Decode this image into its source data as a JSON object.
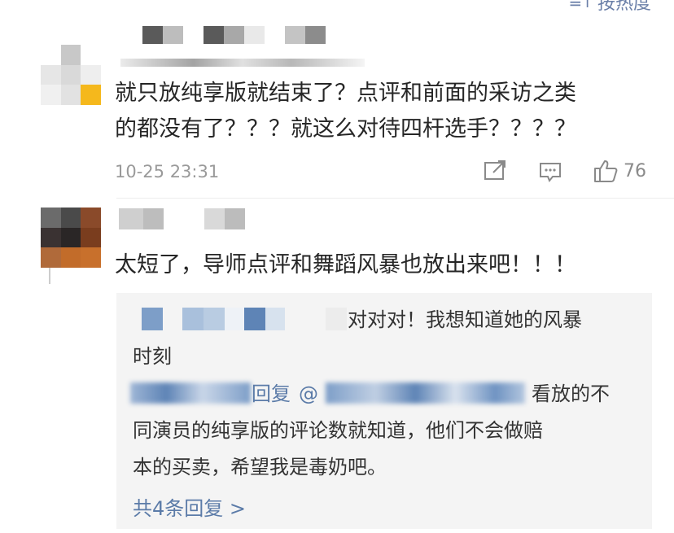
{
  "sort": {
    "icon": "sort-icon",
    "label": "按热度"
  },
  "comments": [
    {
      "text_line1": "就只放纯享版就结束了？点评和前面的采访之类",
      "text_line2": "的都没有了？？？就这么对待四杆选手？？？？",
      "timestamp": "10-25 23:31",
      "like_count": "76"
    },
    {
      "text": "太短了，导师点评和舞蹈风暴也放出来吧！！！",
      "replies": [
        {
          "text_line1": "对对对！我想知道她的风暴",
          "text_line2": "时刻"
        },
        {
          "reply_prefix": "回复",
          "mention_at": "@",
          "text_tail": "看放的不",
          "text_line2": "同演员的纯享版的评论数就知道，他们不会做赔",
          "text_line3": "本的买卖，希望我是毒奶吧。"
        }
      ],
      "more_replies_label": "共4条回复 >"
    }
  ],
  "colors": {
    "link": "#5b7ba8",
    "reply_bg": "#f4f4f4",
    "meta": "#9a9a9a"
  }
}
